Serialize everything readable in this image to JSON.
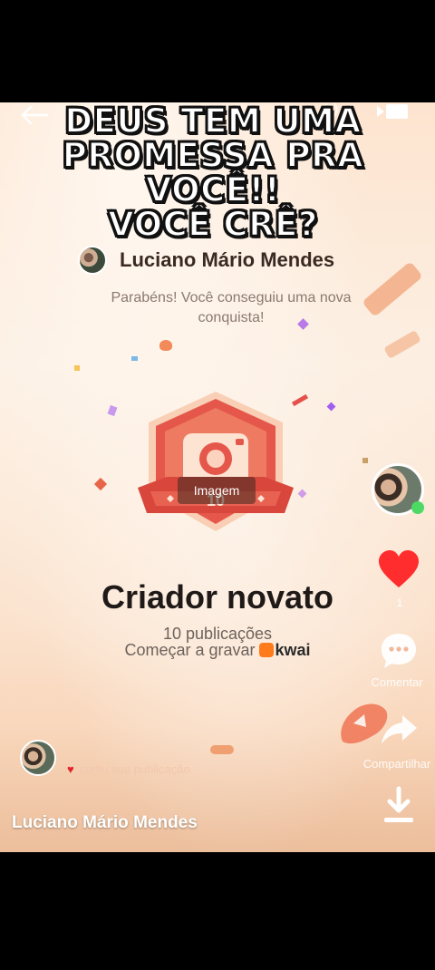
{
  "overlay": {
    "line1": "DEUS TEM UMA",
    "line2": "PROMESSA PRA",
    "line3": "VOCÊ!!",
    "line4": "VOCÊ CRÊ?"
  },
  "profile": {
    "name": "Luciano Mário Mendes"
  },
  "card": {
    "congrats": "Parabéns! Você conseguiu uma nova conquista!",
    "image_label": "Imagem",
    "badge_number": "10",
    "achievement": "Criador novato",
    "publications": "10 publicações",
    "start_recording": "Começar a gravar",
    "brand": "kwai"
  },
  "sidebar": {
    "like_count": "1",
    "comment_label": "Comentar",
    "share_label": "Compartilhar"
  },
  "notification": {
    "action": "curtiu sua publicação"
  },
  "footer": {
    "author": "Luciano Mário Mendes"
  },
  "icons": {
    "back": "back-arrow-icon",
    "more": "more-dots-icon",
    "screen": "cast-icon",
    "like": "heart-icon",
    "comment": "comment-bubble-icon",
    "share": "share-arrow-icon",
    "download": "download-icon"
  },
  "colors": {
    "heart": "#ff2d2d",
    "badge": "#e4574a",
    "background": "#fbe2cd"
  }
}
